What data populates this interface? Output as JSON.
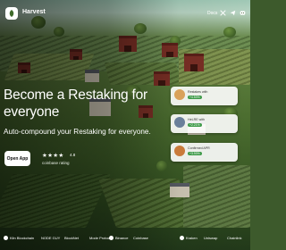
{
  "header": {
    "brand": "Harvest",
    "nav": {
      "docs_label": "Docs"
    },
    "icons": [
      "x-twitter-icon",
      "telegram-icon",
      "discord-icon"
    ]
  },
  "hero": {
    "title": "Become a Restaking for everyone",
    "subtitle": "Auto-compound your Restaking for everyone.",
    "cta_label": "Open App",
    "stars": "★★★★",
    "rating_value": "4.8",
    "rating_label": "coinbase rating"
  },
  "cards": [
    {
      "name": "Restakes with",
      "amount": "+4.50%",
      "avatar_color": "#d9a15a"
    },
    {
      "name": "HeLRE with",
      "amount": "+2.21%",
      "avatar_color": "#6a7f9a"
    },
    {
      "name": "Confirmed APR",
      "amount": "+3.90%",
      "avatar_color": "#c97a3a"
    }
  ],
  "partners": [
    "Kiln Blockchain",
    "NODE GUY",
    "BlockNet",
    "Mode Protocol",
    "Binance",
    "Coinbase",
    "Kraken",
    "Uniswap",
    "Chainlink"
  ],
  "colors": {
    "cta_bg": "#ffffff",
    "brand_text": "#ffffff",
    "badge_green": "#3f9b4a"
  }
}
